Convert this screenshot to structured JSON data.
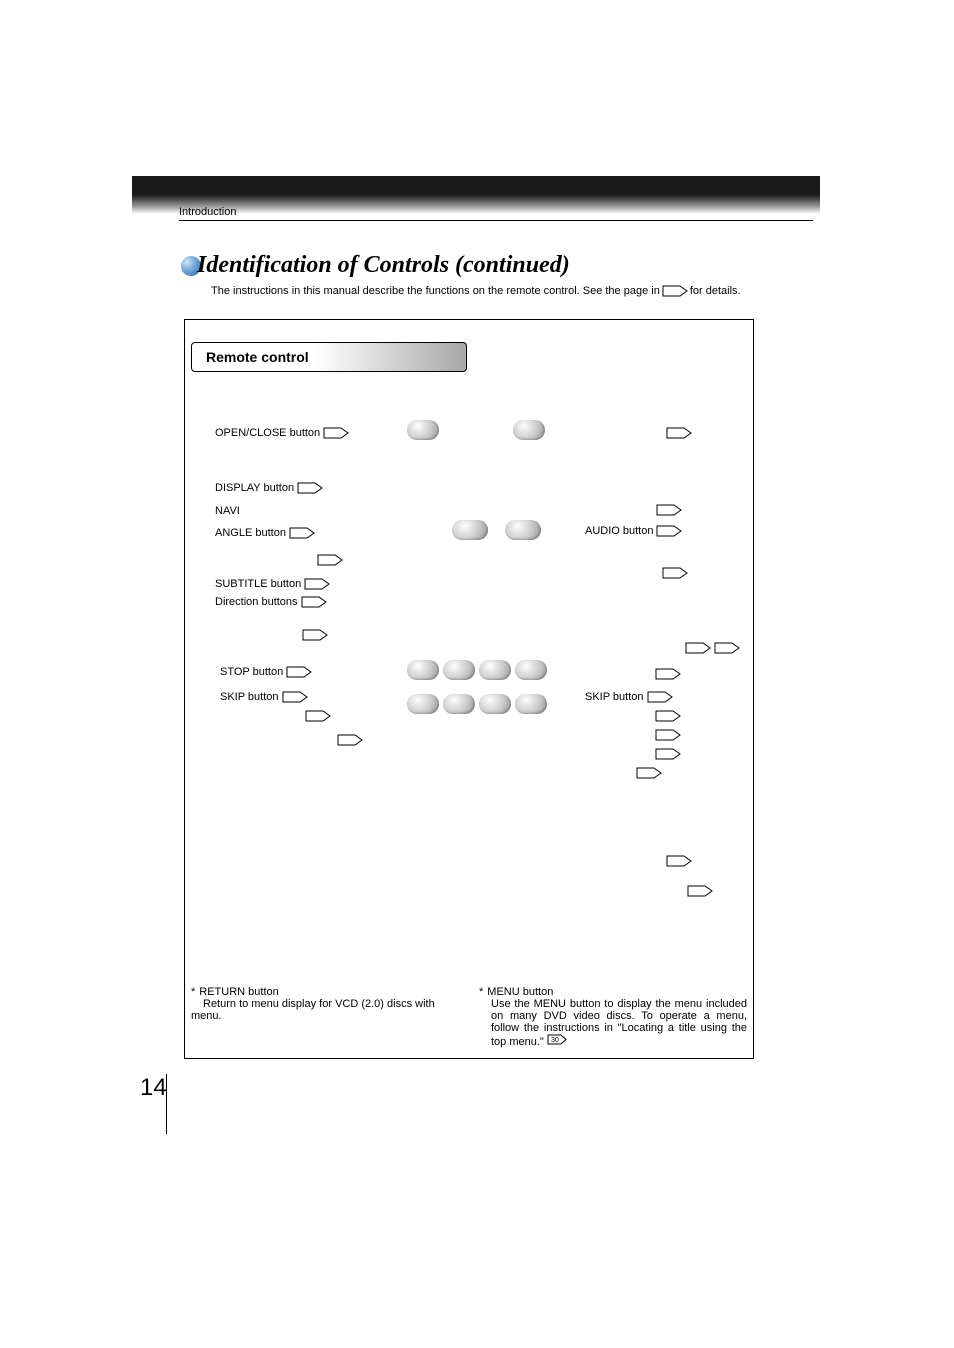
{
  "section": "Introduction",
  "title": "Identification of Controls (continued)",
  "intro_a": "The instructions in this manual describe the functions on the remote control. See the page in ",
  "intro_b": " for details.",
  "box_title": "Remote control",
  "left": {
    "openclose": "OPEN/CLOSE button",
    "display": "DISPLAY button",
    "navi": "NAVI",
    "angle": "ANGLE button",
    "subtitle": "SUBTITLE button",
    "direction": "Direction buttons",
    "stop": "STOP button",
    "skip": "SKIP button"
  },
  "right": {
    "audio": "AUDIO button",
    "skip": "SKIP button"
  },
  "footnote1": {
    "star": "*",
    "head": "RETURN button",
    "body": "Return to menu display for VCD (2.0) discs with menu."
  },
  "footnote2": {
    "star": "*",
    "head": "MENU button",
    "body_a": "Use the MENU button to display the menu included on many DVD video discs. To operate a menu, follow the instructions in \"Locating a title using the top menu.\" ",
    "ref": "30"
  },
  "page_number": "14"
}
